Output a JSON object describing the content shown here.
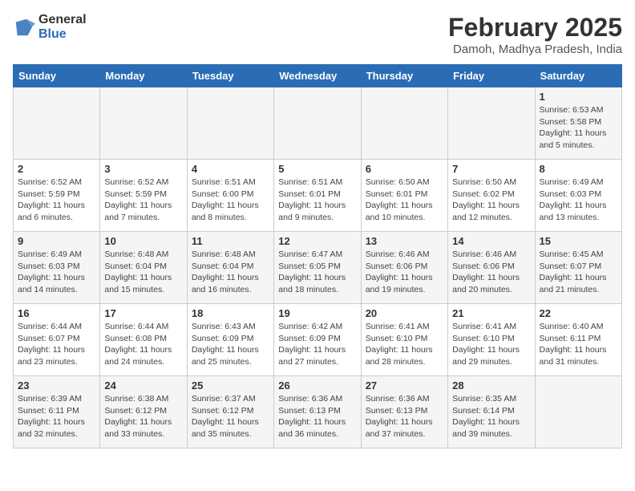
{
  "header": {
    "logo_general": "General",
    "logo_blue": "Blue",
    "title": "February 2025",
    "subtitle": "Damoh, Madhya Pradesh, India"
  },
  "weekdays": [
    "Sunday",
    "Monday",
    "Tuesday",
    "Wednesday",
    "Thursday",
    "Friday",
    "Saturday"
  ],
  "weeks": [
    [
      {
        "day": "",
        "info": ""
      },
      {
        "day": "",
        "info": ""
      },
      {
        "day": "",
        "info": ""
      },
      {
        "day": "",
        "info": ""
      },
      {
        "day": "",
        "info": ""
      },
      {
        "day": "",
        "info": ""
      },
      {
        "day": "1",
        "info": "Sunrise: 6:53 AM\nSunset: 5:58 PM\nDaylight: 11 hours\nand 5 minutes."
      }
    ],
    [
      {
        "day": "2",
        "info": "Sunrise: 6:52 AM\nSunset: 5:59 PM\nDaylight: 11 hours\nand 6 minutes."
      },
      {
        "day": "3",
        "info": "Sunrise: 6:52 AM\nSunset: 5:59 PM\nDaylight: 11 hours\nand 7 minutes."
      },
      {
        "day": "4",
        "info": "Sunrise: 6:51 AM\nSunset: 6:00 PM\nDaylight: 11 hours\nand 8 minutes."
      },
      {
        "day": "5",
        "info": "Sunrise: 6:51 AM\nSunset: 6:01 PM\nDaylight: 11 hours\nand 9 minutes."
      },
      {
        "day": "6",
        "info": "Sunrise: 6:50 AM\nSunset: 6:01 PM\nDaylight: 11 hours\nand 10 minutes."
      },
      {
        "day": "7",
        "info": "Sunrise: 6:50 AM\nSunset: 6:02 PM\nDaylight: 11 hours\nand 12 minutes."
      },
      {
        "day": "8",
        "info": "Sunrise: 6:49 AM\nSunset: 6:03 PM\nDaylight: 11 hours\nand 13 minutes."
      }
    ],
    [
      {
        "day": "9",
        "info": "Sunrise: 6:49 AM\nSunset: 6:03 PM\nDaylight: 11 hours\nand 14 minutes."
      },
      {
        "day": "10",
        "info": "Sunrise: 6:48 AM\nSunset: 6:04 PM\nDaylight: 11 hours\nand 15 minutes."
      },
      {
        "day": "11",
        "info": "Sunrise: 6:48 AM\nSunset: 6:04 PM\nDaylight: 11 hours\nand 16 minutes."
      },
      {
        "day": "12",
        "info": "Sunrise: 6:47 AM\nSunset: 6:05 PM\nDaylight: 11 hours\nand 18 minutes."
      },
      {
        "day": "13",
        "info": "Sunrise: 6:46 AM\nSunset: 6:06 PM\nDaylight: 11 hours\nand 19 minutes."
      },
      {
        "day": "14",
        "info": "Sunrise: 6:46 AM\nSunset: 6:06 PM\nDaylight: 11 hours\nand 20 minutes."
      },
      {
        "day": "15",
        "info": "Sunrise: 6:45 AM\nSunset: 6:07 PM\nDaylight: 11 hours\nand 21 minutes."
      }
    ],
    [
      {
        "day": "16",
        "info": "Sunrise: 6:44 AM\nSunset: 6:07 PM\nDaylight: 11 hours\nand 23 minutes."
      },
      {
        "day": "17",
        "info": "Sunrise: 6:44 AM\nSunset: 6:08 PM\nDaylight: 11 hours\nand 24 minutes."
      },
      {
        "day": "18",
        "info": "Sunrise: 6:43 AM\nSunset: 6:09 PM\nDaylight: 11 hours\nand 25 minutes."
      },
      {
        "day": "19",
        "info": "Sunrise: 6:42 AM\nSunset: 6:09 PM\nDaylight: 11 hours\nand 27 minutes."
      },
      {
        "day": "20",
        "info": "Sunrise: 6:41 AM\nSunset: 6:10 PM\nDaylight: 11 hours\nand 28 minutes."
      },
      {
        "day": "21",
        "info": "Sunrise: 6:41 AM\nSunset: 6:10 PM\nDaylight: 11 hours\nand 29 minutes."
      },
      {
        "day": "22",
        "info": "Sunrise: 6:40 AM\nSunset: 6:11 PM\nDaylight: 11 hours\nand 31 minutes."
      }
    ],
    [
      {
        "day": "23",
        "info": "Sunrise: 6:39 AM\nSunset: 6:11 PM\nDaylight: 11 hours\nand 32 minutes."
      },
      {
        "day": "24",
        "info": "Sunrise: 6:38 AM\nSunset: 6:12 PM\nDaylight: 11 hours\nand 33 minutes."
      },
      {
        "day": "25",
        "info": "Sunrise: 6:37 AM\nSunset: 6:12 PM\nDaylight: 11 hours\nand 35 minutes."
      },
      {
        "day": "26",
        "info": "Sunrise: 6:36 AM\nSunset: 6:13 PM\nDaylight: 11 hours\nand 36 minutes."
      },
      {
        "day": "27",
        "info": "Sunrise: 6:36 AM\nSunset: 6:13 PM\nDaylight: 11 hours\nand 37 minutes."
      },
      {
        "day": "28",
        "info": "Sunrise: 6:35 AM\nSunset: 6:14 PM\nDaylight: 11 hours\nand 39 minutes."
      },
      {
        "day": "",
        "info": ""
      }
    ]
  ]
}
